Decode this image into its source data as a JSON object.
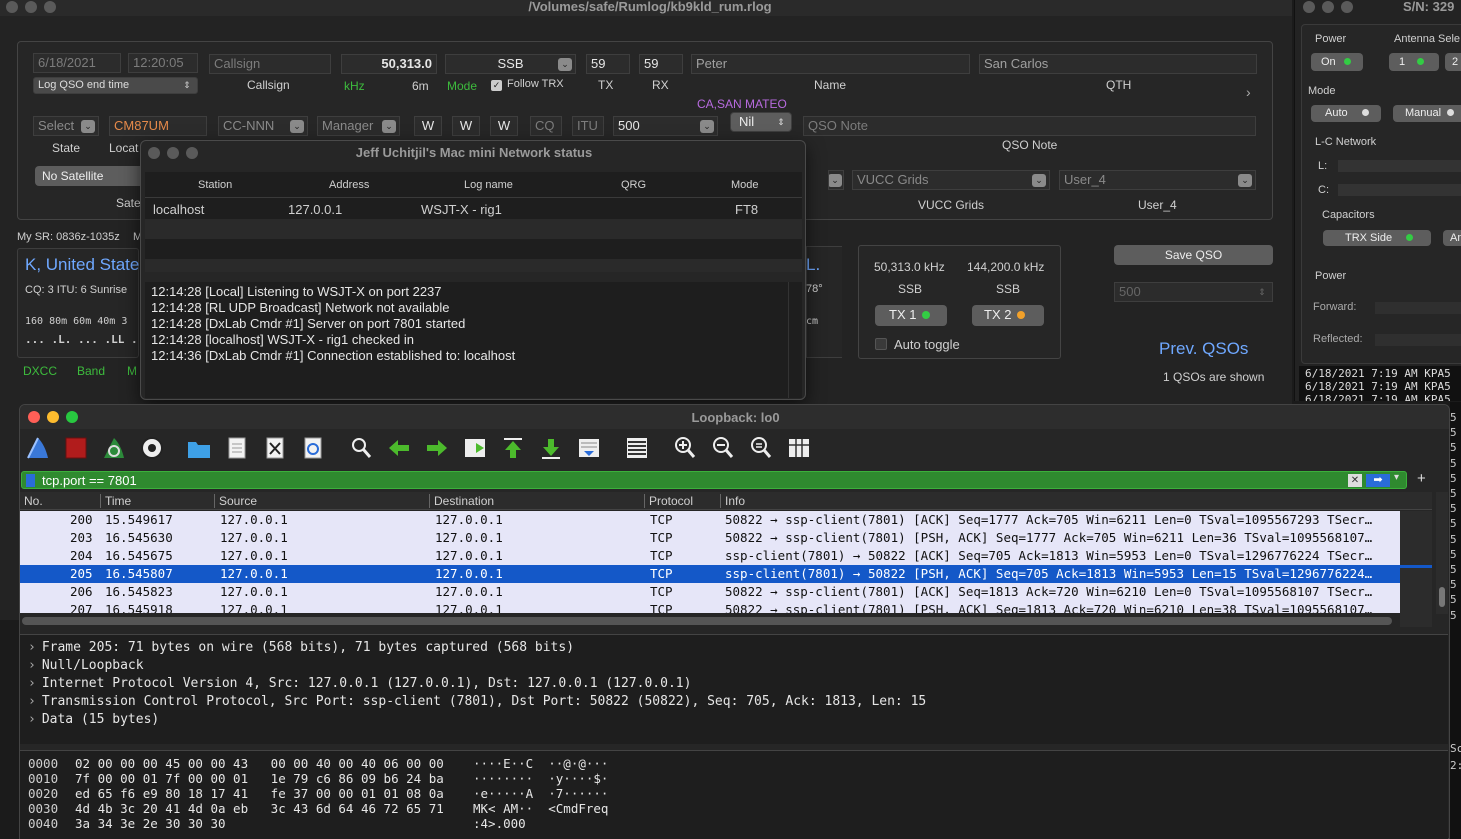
{
  "rumlog": {
    "title": "/Volumes/safe/Rumlog/kb9kld_rum.rlog",
    "date": "6/18/2021",
    "time": "12:20:05",
    "log_end_select": "Log QSO end time",
    "callsign_placeholder": "Callsign",
    "callsign_label": "Callsign",
    "freq_value": "50,313.0",
    "freq_unit": "kHz",
    "band": "6m",
    "mode_value": "SSB",
    "mode_label": "Mode",
    "follow_trx_label": "Follow TRX",
    "tx_value": "59",
    "rx_value": "59",
    "tx_label": "TX",
    "rx_label": "RX",
    "name_value": "Peter",
    "name_label": "Name",
    "qth_value": "San Carlos",
    "qth_label": "QTH",
    "county": "CA,SAN MATEO",
    "state_select": "Select",
    "state_label": "State",
    "locator_value": "CM87UM",
    "locator_label": "Locat",
    "cc_select": "CC-NNN",
    "manager_select": "Manager",
    "w1": "W",
    "w2": "W",
    "w3": "W",
    "cq_placeholder": "CQ",
    "itu_placeholder": "ITU",
    "power_value": "500",
    "nil_select": "Nil",
    "qso_note_placeholder": "QSO Note",
    "qso_note_label": "QSO Note",
    "no_satellite": "No Satellite",
    "sat_label": "Sate",
    "vucc_select": "VUCC Grids",
    "vucc_label": "VUCC Grids",
    "user4_select": "User_4",
    "user4_label": "User_4",
    "my_sr": "My SR: 0836z-1035z",
    "my_sr_tail": "M",
    "country": "K, United States",
    "cq_itu": "CQ: 3  ITU: 6  Sunrise",
    "bands_row": "160 80m 60m 40m 3",
    "bands_marks": "... .L. ... .LL .",
    "dxcc_label": "DXCC",
    "band_label": "Band",
    "m_label": "M",
    "right_letter": "L.",
    "bearing": "78°",
    "cm_text": "cm",
    "vfo_a_freq": "50,313.0 kHz",
    "vfo_b_freq": "144,200.0 kHz",
    "vfo_a_mode": "SSB",
    "vfo_b_mode": "SSB",
    "tx1_label": "TX 1",
    "tx2_label": "TX 2",
    "auto_toggle": "Auto toggle",
    "save_qso": "Save QSO",
    "power_select": "500",
    "prev_qsos": "Prev. QSOs",
    "qsos_shown": "1 QSOs are shown",
    "colors": {
      "green": "#3dbb3d",
      "purple": "#b86be0",
      "tx1_dot": "#33cc44",
      "tx2_dot": "#f2a12a"
    }
  },
  "netstatus": {
    "title": "Jeff Uchitjil's Mac mini Network status",
    "columns": [
      "Station",
      "Address",
      "Log name",
      "QRG",
      "Mode"
    ],
    "row": {
      "station": "localhost",
      "address": "127.0.0.1",
      "log_name": "WSJT-X - rig1",
      "qrg": "",
      "mode": "FT8"
    },
    "log_lines": [
      "12:14:28 [Local] Listening to WSJT-X on port 2237",
      "12:14:28 [RL UDP Broadcast] Network not available",
      "12:14:28 [DxLab Cmdr #1] Server on port 7801 started",
      "12:14:28 [localhost] WSJT-X - rig1 checked in",
      "12:14:36 [DxLab Cmdr #1] Connection established to: localhost"
    ]
  },
  "rightpanel": {
    "title": "S/N: 329",
    "power_label": "Power",
    "antenna_label": "Antenna Sele",
    "power_on": "On",
    "antenna_1": "1",
    "antenna_2": "2",
    "mode_label": "Mode",
    "auto_label": "Auto",
    "manual_label": "Manual",
    "lc_network": "L-C Network",
    "l_label": "L:",
    "c_label": "C:",
    "capacitors": "Capacitors",
    "trx_side": "TRX Side",
    "ant_side": "An",
    "power_section": "Power",
    "forward": "Forward:",
    "reflected": "Reflected:",
    "log_lines": [
      "6/18/2021 7:19 AM KPA5",
      "6/18/2021 7:19 AM KPA5",
      "6/18/2021 7:19 AM KPA5"
    ],
    "side_digits": [
      "5",
      "5",
      "5",
      "5",
      "5",
      "5",
      "5",
      "5",
      "5",
      "5",
      "5",
      "5",
      "5",
      "5"
    ],
    "side_bottom": [
      "Sc",
      "2:1"
    ]
  },
  "wireshark": {
    "title": "Loopback: lo0",
    "filter": "tcp.port == 7801",
    "columns": [
      "No.",
      "Time",
      "Source",
      "Destination",
      "Protocol",
      "Info"
    ],
    "packets": [
      {
        "no": "200",
        "time": "15.549617",
        "src": "127.0.0.1",
        "dst": "127.0.0.1",
        "proto": "TCP",
        "info": "50822 → ssp-client(7801) [ACK] Seq=1777 Ack=705 Win=6211 Len=0 TSval=1095567293 TSecr…"
      },
      {
        "no": "203",
        "time": "16.545630",
        "src": "127.0.0.1",
        "dst": "127.0.0.1",
        "proto": "TCP",
        "info": "50822 → ssp-client(7801) [PSH, ACK] Seq=1777 Ack=705 Win=6211 Len=36 TSval=1095568107…"
      },
      {
        "no": "204",
        "time": "16.545675",
        "src": "127.0.0.1",
        "dst": "127.0.0.1",
        "proto": "TCP",
        "info": "ssp-client(7801) → 50822 [ACK] Seq=705 Ack=1813 Win=5953 Len=0 TSval=1296776224 TSecr…"
      },
      {
        "no": "205",
        "time": "16.545807",
        "src": "127.0.0.1",
        "dst": "127.0.0.1",
        "proto": "TCP",
        "info": "ssp-client(7801) → 50822 [PSH, ACK] Seq=705 Ack=1813 Win=5953 Len=15 TSval=1296776224…"
      },
      {
        "no": "206",
        "time": "16.545823",
        "src": "127.0.0.1",
        "dst": "127.0.0.1",
        "proto": "TCP",
        "info": "50822 → ssp-client(7801) [ACK] Seq=1813 Ack=720 Win=6210 Len=0 TSval=1095568107 TSecr…"
      },
      {
        "no": "207",
        "time": "16.545918",
        "src": "127.0.0.1",
        "dst": "127.0.0.1",
        "proto": "TCP",
        "info": "50822 → ssp-client(7801) [PSH, ACK] Seq=1813 Ack=720 Win=6210 Len=38 TSval=1095568107…"
      }
    ],
    "selected_no": "205",
    "details": [
      "Frame 205: 71 bytes on wire (568 bits), 71 bytes captured (568 bits)",
      "Null/Loopback",
      "Internet Protocol Version 4, Src: 127.0.0.1 (127.0.0.1), Dst: 127.0.0.1 (127.0.0.1)",
      "Transmission Control Protocol, Src Port: ssp-client (7801), Dst Port: 50822 (50822), Seq: 705, Ack: 1813, Len: 15",
      "Data (15 bytes)"
    ],
    "hex": [
      {
        "off": "0000",
        "bytes": "02 00 00 00 45 00 00 43   00 00 40 00 40 06 00 00",
        "ascii": "····E··C  ··@·@···"
      },
      {
        "off": "0010",
        "bytes": "7f 00 00 01 7f 00 00 01   1e 79 c6 86 09 b6 24 ba",
        "ascii": "········  ·y····$·"
      },
      {
        "off": "0020",
        "bytes": "ed 65 f6 e9 80 18 17 41   fe 37 00 00 01 01 08 0a",
        "ascii": "·e·····A  ·7······"
      },
      {
        "off": "0030",
        "bytes": "4d 4b 3c 20 41 4d 0a eb   3c 43 6d 64 46 72 65 71",
        "ascii": "MK< AM··  <CmdFreq"
      },
      {
        "off": "0040",
        "bytes": "3a 34 3e 2e 30 30 30",
        "ascii": ":4>.000"
      }
    ],
    "colors": {
      "filter_bg": "#1e8a1e",
      "row_bg": "#e6e6f8",
      "selected_bg": "#1458c8"
    }
  }
}
